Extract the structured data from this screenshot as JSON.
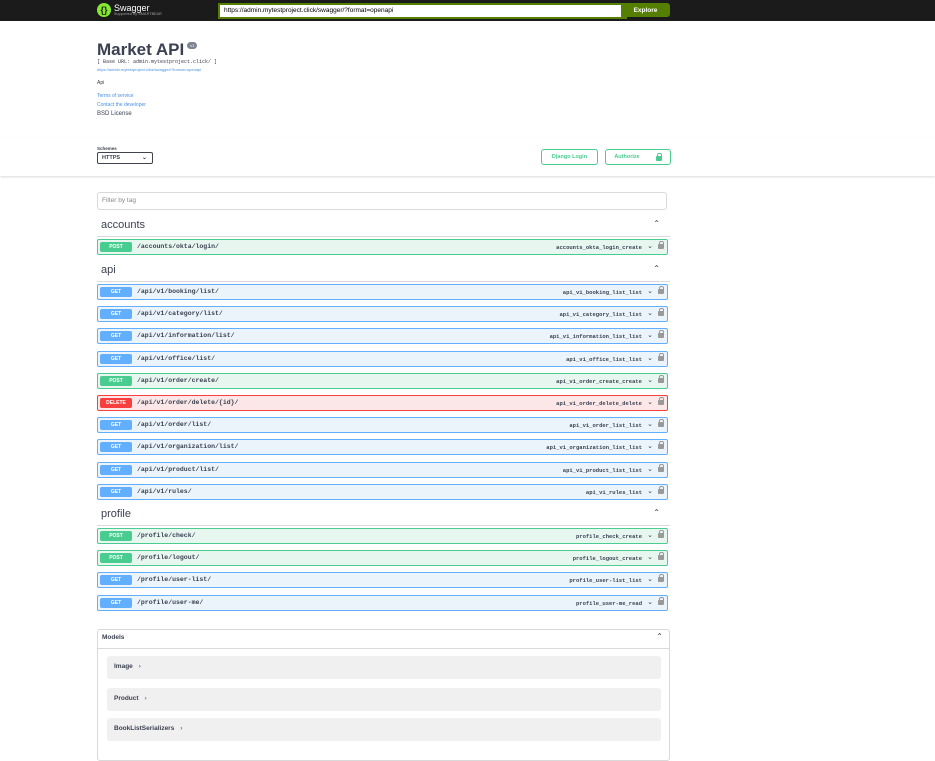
{
  "topbar": {
    "logo_text": "Swagger",
    "logo_sub": "Supported by SMARTBEAR",
    "url_value": "https://admin.mytestproject.click/swagger/?format=openapi",
    "explore_label": "Explore"
  },
  "info": {
    "title": "Market API",
    "version": "v1",
    "base_url": "[ Base URL: admin.mytestproject.click/ ]",
    "spec_link": "https://admin.mytestproject.click/swagger/?format=openapi",
    "description": "Api",
    "terms": "Terms of service",
    "contact": "Contact the developer",
    "license": "BSD License"
  },
  "schemes": {
    "label": "Schemes",
    "selected": "HTTPS",
    "django_login": "Django Login",
    "authorize": "Authorize"
  },
  "filter": {
    "placeholder": "Filter by tag"
  },
  "tags": [
    {
      "name": "accounts",
      "ops": [
        {
          "method": "POST",
          "path": "/accounts/okta/login/",
          "id": "accounts_okta_login_create"
        }
      ]
    },
    {
      "name": "api",
      "ops": [
        {
          "method": "GET",
          "path": "/api/v1/booking/list/",
          "id": "api_v1_booking_list_list"
        },
        {
          "method": "GET",
          "path": "/api/v1/category/list/",
          "id": "api_v1_category_list_list"
        },
        {
          "method": "GET",
          "path": "/api/v1/information/list/",
          "id": "api_v1_information_list_list"
        },
        {
          "method": "GET",
          "path": "/api/v1/office/list/",
          "id": "api_v1_office_list_list"
        },
        {
          "method": "POST",
          "path": "/api/v1/order/create/",
          "id": "api_v1_order_create_create"
        },
        {
          "method": "DELETE",
          "path": "/api/v1/order/delete/{id}/",
          "id": "api_v1_order_delete_delete"
        },
        {
          "method": "GET",
          "path": "/api/v1/order/list/",
          "id": "api_v1_order_list_list"
        },
        {
          "method": "GET",
          "path": "/api/v1/organization/list/",
          "id": "api_v1_organization_list_list"
        },
        {
          "method": "GET",
          "path": "/api/v1/product/list/",
          "id": "api_v1_product_list_list"
        },
        {
          "method": "GET",
          "path": "/api/v1/rules/",
          "id": "api_v1_rules_list"
        }
      ]
    },
    {
      "name": "profile",
      "ops": [
        {
          "method": "POST",
          "path": "/profile/check/",
          "id": "profile_check_create"
        },
        {
          "method": "POST",
          "path": "/profile/logout/",
          "id": "profile_logout_create"
        },
        {
          "method": "GET",
          "path": "/profile/user-list/",
          "id": "profile_user-list_list"
        },
        {
          "method": "GET",
          "path": "/profile/user-me/",
          "id": "profile_user-me_read"
        }
      ]
    }
  ],
  "models": {
    "label": "Models",
    "items": [
      "Image",
      "Product",
      "BookListSerializers"
    ]
  },
  "colors": {
    "get": "#61affe",
    "post": "#49cc90",
    "delete": "#f93e3e",
    "topbar": "#1b1b1b",
    "explore": "#547f00"
  }
}
